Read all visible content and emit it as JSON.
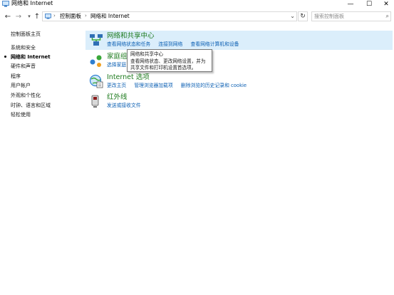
{
  "window": {
    "title": "网络和 Internet",
    "minimize": "—",
    "maximize": "☐",
    "close": "✕"
  },
  "nav": {
    "back": "←",
    "forward": "→",
    "recent_dropdown": "▾",
    "up": "↑",
    "breadcrumb": [
      "控制面板",
      "网络和 Internet"
    ],
    "separator": "›",
    "address_dropdown": "⌄",
    "refresh": "↻",
    "search_placeholder": "搜索控制面板",
    "search_icon": "⌕"
  },
  "sidebar": {
    "items": [
      {
        "label": "控制面板主页",
        "active": false
      },
      {
        "label": "系统和安全",
        "active": false
      },
      {
        "label": "网络和 Internet",
        "active": true
      },
      {
        "label": "硬件和声音",
        "active": false
      },
      {
        "label": "程序",
        "active": false
      },
      {
        "label": "用户帐户",
        "active": false
      },
      {
        "label": "外观和个性化",
        "active": false
      },
      {
        "label": "时钟、语言和区域",
        "active": false
      },
      {
        "label": "轻松使用",
        "active": false
      }
    ]
  },
  "categories": [
    {
      "title": "网络和共享中心",
      "links": [
        "查看网络状态和任务",
        "连接到网络",
        "查看网络计算机和设备"
      ],
      "icon": "network-sharing-center-icon"
    },
    {
      "title": "家庭组",
      "links": [
        "选择家庭"
      ],
      "icon": "homegroup-icon"
    },
    {
      "title": "Internet 选项",
      "links": [
        "更改主页",
        "管理浏览器加载项",
        "删除浏览的历史记录和 cookie"
      ],
      "icon": "internet-options-icon"
    },
    {
      "title": "红外线",
      "links": [
        "发送或接收文件"
      ],
      "icon": "infrared-icon"
    }
  ],
  "tooltip": {
    "lines": [
      "网络和共享中心",
      "查看网络状态、更改网络设置，并为",
      "共享文件和打印机设置首选项。"
    ]
  },
  "colors": {
    "category_title": "#1e7b1e",
    "link": "#0b5fb3",
    "hover_highlight": "#dbeefb"
  }
}
